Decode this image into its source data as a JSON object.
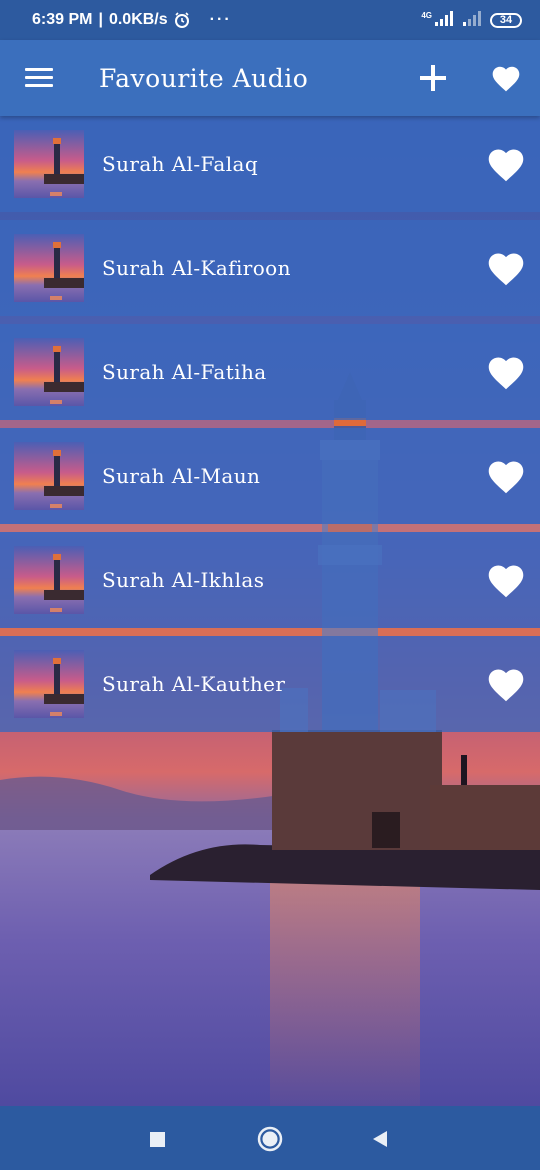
{
  "status_bar": {
    "time": "6:39 PM",
    "separator": "|",
    "net_speed": "0.0KB/s",
    "more": "···",
    "network_type": "4G",
    "battery": "34"
  },
  "app_bar": {
    "title": "Favourite Audio",
    "menu_icon": "hamburger-menu-icon",
    "add_icon": "plus-icon",
    "favourites_icon": "heart-icon"
  },
  "favourites": [
    {
      "title": "Surah Al-Falaq",
      "favourited": true
    },
    {
      "title": "Surah Al-Kafiroon",
      "favourited": true
    },
    {
      "title": "Surah Al-Fatiha",
      "favourited": true
    },
    {
      "title": "Surah Al-Maun",
      "favourited": true
    },
    {
      "title": "Surah Al-Ikhlas",
      "favourited": true
    },
    {
      "title": "Surah Al-Kauther",
      "favourited": true
    }
  ],
  "nav_bar": {
    "recent_icon": "square-recents-icon",
    "home_icon": "circle-home-icon",
    "back_icon": "triangle-back-icon"
  },
  "colors": {
    "app_bar": "#3b6fbd",
    "status_bar": "#2d5a9f",
    "nav_bar": "#2c5aa0",
    "list_row": "#3a68be",
    "icon": "#ffffff"
  }
}
